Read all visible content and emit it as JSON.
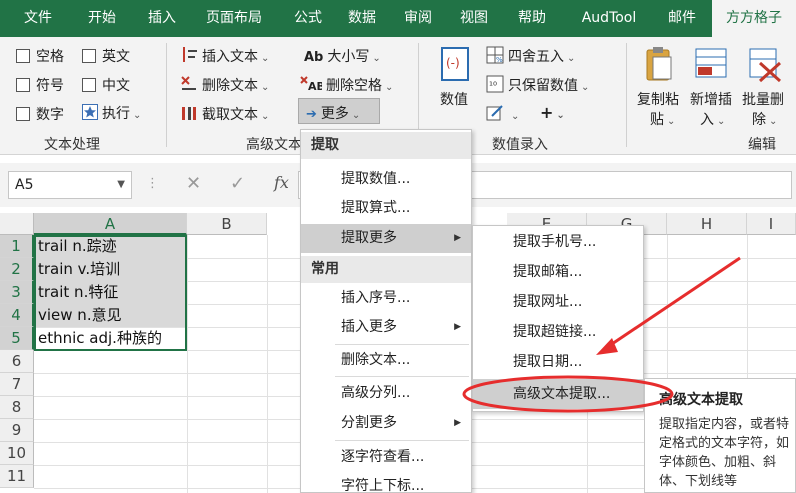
{
  "tabs": [
    "文件",
    "开始",
    "插入",
    "页面布局",
    "公式",
    "数据",
    "审阅",
    "视图",
    "帮助",
    "AudTool",
    "邮件",
    "方方格子"
  ],
  "active_tab": "方方格子",
  "ribbon": {
    "text_group": {
      "checkboxes": [
        "空格",
        "英文",
        "符号",
        "中文",
        "数字"
      ],
      "execute": "执行",
      "label": "文本处理"
    },
    "adv_group": {
      "insert_text": "插入文本",
      "delete_text": "删除文本",
      "cut_text": "截取文本",
      "case": "大小写",
      "delete_space": "删除空格",
      "more": "更多",
      "label": "高级文本"
    },
    "num_group": {
      "value": "数值",
      "round": "四舍五入",
      "keep_value": "只保留数值",
      "plus": "+",
      "label": "数值录入"
    },
    "edit_group": {
      "copy_paste_1": "复制粘",
      "copy_paste_2": "贴",
      "new_insert_1": "新增插",
      "new_insert_2": "入",
      "batch_delete_1": "批量删",
      "batch_delete_2": "除",
      "label": "编辑"
    }
  },
  "formula_bar": {
    "name_box": "A5",
    "fx": "fx"
  },
  "columns": [
    "A",
    "B",
    "E",
    "G",
    "H",
    "I"
  ],
  "rows": [
    "1",
    "2",
    "3",
    "4",
    "5",
    "6",
    "7",
    "8",
    "9",
    "10",
    "11"
  ],
  "cells": [
    "trail n.踪迹",
    "train v.培训",
    "trait n.特征",
    "view n.意见",
    "ethnic adj.种族的"
  ],
  "menu1": {
    "header_extract": "提取",
    "extract_value": "提取数值...",
    "extract_formula": "提取算式...",
    "extract_more": "提取更多",
    "header_common": "常用",
    "insert_serial": "插入序号...",
    "insert_more": "插入更多",
    "delete_text": "删除文本...",
    "adv_split": "高级分列...",
    "split_more": "分割更多",
    "char_view": "逐字符查看...",
    "char_sub": "字符上下标..."
  },
  "menu2": [
    "提取手机号...",
    "提取邮箱...",
    "提取网址...",
    "提取超链接...",
    "提取日期...",
    "高级文本提取..."
  ],
  "tooltip": {
    "title": "高级文本提取",
    "body": "提取指定内容，或者特定格式的文本字符，如字体颜色、加粗、斜体、下划线等"
  },
  "colors": {
    "excel_green": "#217346",
    "annotation_red": "#e62d2d"
  },
  "icons": [
    "dropdown-arrow-icon",
    "cancel-x-icon",
    "check-icon",
    "star-icon",
    "arrow-right-icon"
  ]
}
